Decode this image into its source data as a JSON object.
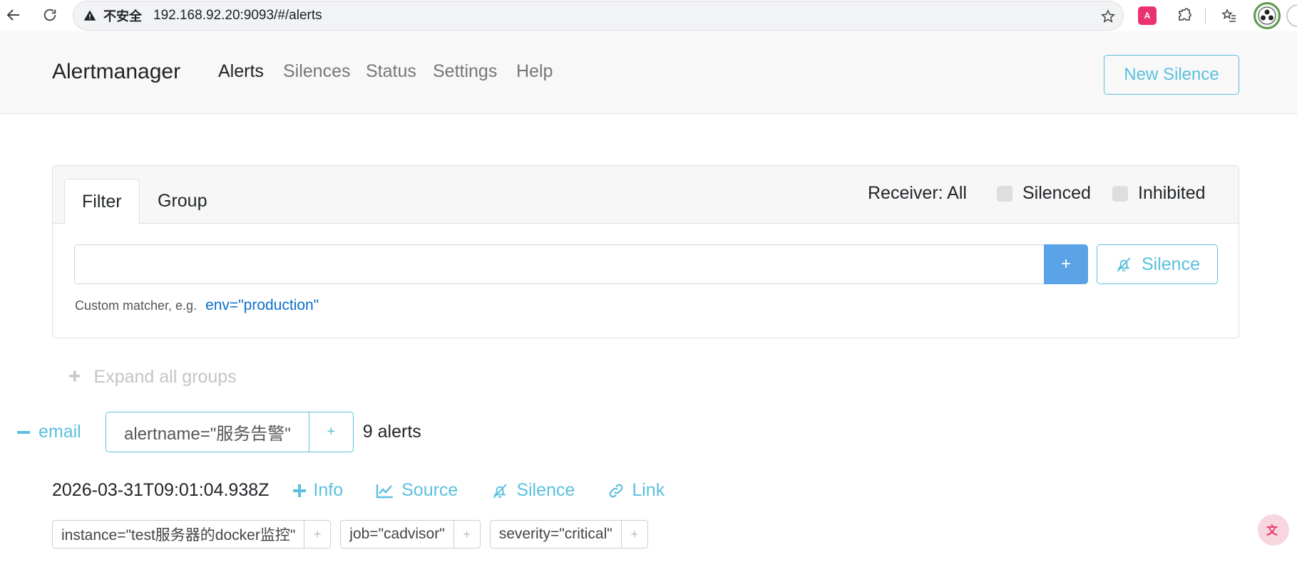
{
  "browser": {
    "security_label": "不安全",
    "url": "192.168.92.20:9093/#/alerts",
    "translate_ext_label": "A"
  },
  "app": {
    "brand": "Alertmanager",
    "nav": [
      {
        "label": "Alerts",
        "active": true
      },
      {
        "label": "Silences",
        "active": false
      },
      {
        "label": "Status",
        "active": false
      },
      {
        "label": "Settings",
        "active": false
      },
      {
        "label": "Help",
        "active": false
      }
    ],
    "new_silence_label": "New Silence"
  },
  "filter": {
    "tabs": [
      {
        "label": "Filter",
        "active": true
      },
      {
        "label": "Group",
        "active": false
      }
    ],
    "receiver_label": "Receiver: All",
    "silenced_label": "Silenced",
    "inhibited_label": "Inhibited",
    "input_value": "",
    "add_button_label": "+",
    "silence_button_label": "Silence",
    "hint_text": "Custom matcher, e.g.",
    "hint_example": "env=\"production\""
  },
  "groups": {
    "expand_all_label": "Expand all groups",
    "group": {
      "receiver": "email",
      "matcher": "alertname=\"服务告警\"",
      "matcher_plus": "+",
      "alert_count": "9 alerts"
    },
    "alert": {
      "timestamp": "2026-03-31T09:01:04.938Z",
      "actions": {
        "info": "Info",
        "source": "Source",
        "silence": "Silence",
        "link": "Link"
      },
      "labels": [
        {
          "text": "instance=\"test服务器的docker监控\"",
          "plus": "+"
        },
        {
          "text": "job=\"cadvisor\"",
          "plus": "+"
        },
        {
          "text": "severity=\"critical\"",
          "plus": "+"
        }
      ]
    }
  },
  "colors": {
    "accent": "#5bc0de",
    "primary_button": "#5aa3e6",
    "link_blue": "#0b6fc8",
    "muted": "#c4c4c4"
  }
}
